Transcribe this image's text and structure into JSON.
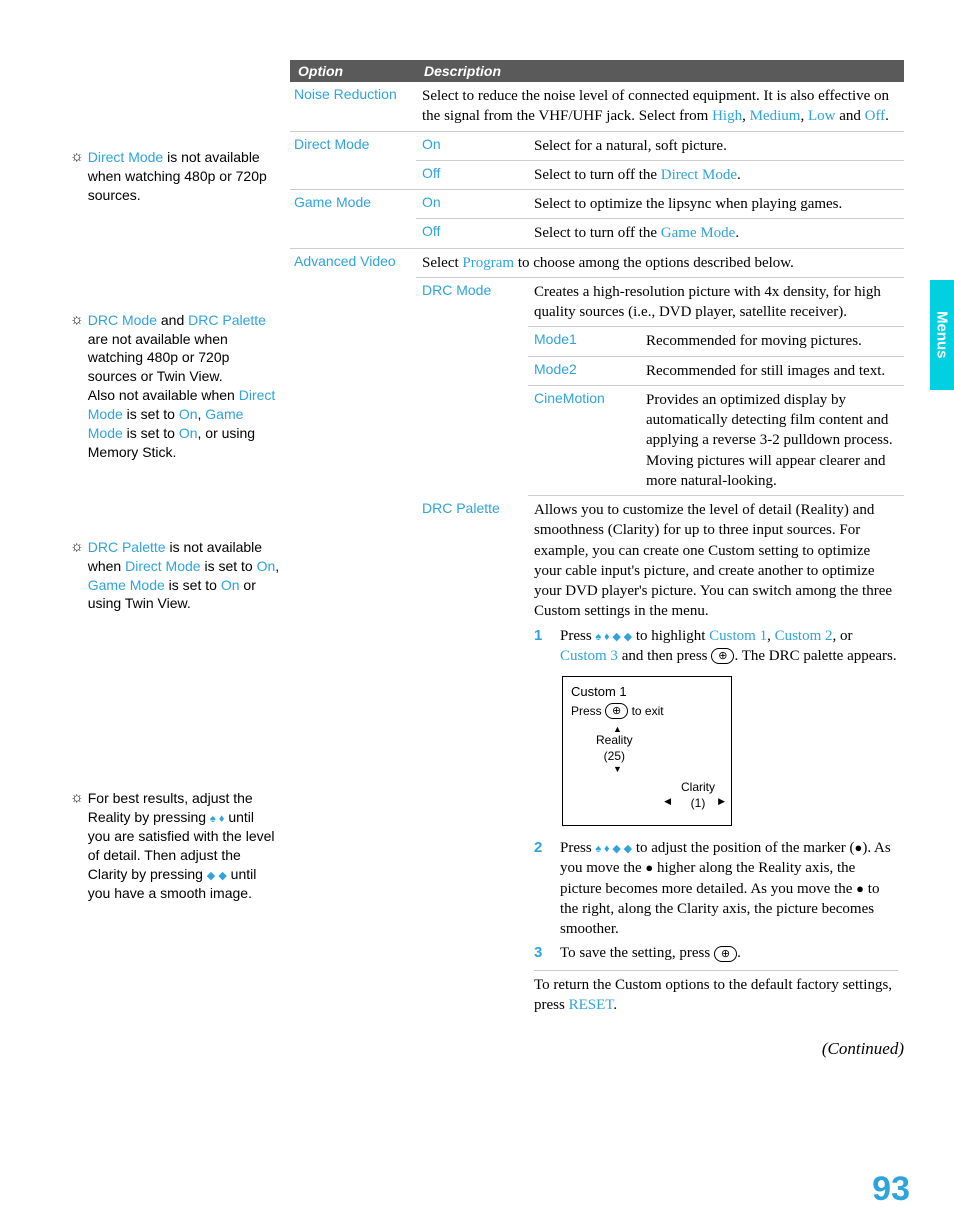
{
  "sideTab": "Menus",
  "pageNumber": "93",
  "continued": "(Continued)",
  "notes": {
    "n1": {
      "pre": "Direct Mode",
      "post": " is not available when watching 480p or 720p sources."
    },
    "n2": {
      "a": "DRC Mode",
      "and": " and ",
      "b": "DRC Palette",
      "l1": " are not available when watching 480p or 720p sources or Twin View.",
      "l2a": "Also not available when ",
      "dm": "Direct Mode",
      "set1": " is set to ",
      "on1": "On",
      "c1": ", ",
      "gm": "Game Mode",
      "set2": " is set to ",
      "on2": "On",
      "l2b": ", or using Memory Stick."
    },
    "n3": {
      "a": "DRC Palette",
      "l1": " is not available when ",
      "dm": "Direct Mode",
      "set1": " is set to ",
      "on1": "On",
      "c1": ", ",
      "gm": "Game Mode",
      "set2": " is set to ",
      "on2": "On",
      "l2": " or using Twin View."
    },
    "n4": {
      "l1": "For best results, adjust the Reality by pressing ",
      "l2": " until you are satisfied with the level of detail. Then adjust the Clarity by pressing ",
      "l3": " until you have a smooth image."
    }
  },
  "table": {
    "hOption": "Option",
    "hDesc": "Description",
    "noiseRed": {
      "label": "Noise Reduction",
      "desc1": "Select to reduce the noise level of connected equipment. It is also effective on the signal from the VHF/UHF jack. Select from ",
      "high": "High",
      "c1": ", ",
      "med": "Medium",
      "c2": ", ",
      "low": "Low",
      "and": " and ",
      "off": "Off",
      "dot": "."
    },
    "directMode": {
      "label": "Direct Mode",
      "onLbl": "On",
      "onDesc": "Select for a natural, soft picture.",
      "offLbl": "Off",
      "offDesc1": "Select to turn off the ",
      "offLink": "Direct Mode",
      "offDesc2": "."
    },
    "gameMode": {
      "label": "Game Mode",
      "onLbl": "On",
      "onDesc": "Select to optimize the lipsync when playing games.",
      "offLbl": "Off",
      "offDesc1": "Select to turn off the ",
      "offLink": "Game Mode",
      "offDesc2": "."
    },
    "advVideo": {
      "label": "Advanced Video",
      "intro1": "Select ",
      "program": "Program",
      "intro2": " to choose among the options described below.",
      "drcMode": {
        "label": "DRC Mode",
        "desc": "Creates a high-resolution picture with 4x density, for high quality sources (i.e., DVD player, satellite receiver).",
        "m1Lbl": "Mode1",
        "m1Desc": "Recommended for moving pictures.",
        "m2Lbl": "Mode2",
        "m2Desc": "Recommended for still images and text.",
        "cmLbl": "CineMotion",
        "cmDesc": "Provides an optimized display by automatically detecting film content and applying a reverse 3-2 pulldown process. Moving pictures will appear clearer and more natural-looking."
      },
      "drcPal": {
        "label": "DRC Palette",
        "desc": "Allows you to customize the level of detail (Reality) and smoothness (Clarity) for up to three input sources. For example, you can create one Custom setting to optimize your cable input's picture, and create another to optimize your DVD player's picture. You can switch among the three Custom settings in the menu.",
        "s1n": "1",
        "s1a": "Press ",
        "s1b": " to highlight ",
        "c1": "Custom 1",
        "cm": ", ",
        "c2": "Custom 2",
        "or": ", or ",
        "c3": "Custom 3",
        "s1c": " and then press ",
        "s1d": ". The DRC palette appears.",
        "dTitle": "Custom 1",
        "dPress": "Press ",
        "dExit": " to exit",
        "dReality": "Reality",
        "dRVal": "(25)",
        "dClarity": "Clarity",
        "dCVal": "(1)",
        "s2n": "2",
        "s2a": "Press ",
        "s2b": " to adjust the position of the marker (",
        "s2c": "). As you move the ",
        "s2d": " higher along the Reality axis, the picture becomes more detailed. As you move the ",
        "s2e": " to the right, along the Clarity axis, the picture becomes smoother.",
        "s3n": "3",
        "s3a": "To save the setting, press ",
        "s3b": ".",
        "ret1": "To return the Custom options to the default factory settings, press ",
        "reset": "RESET",
        "ret2": "."
      }
    }
  }
}
